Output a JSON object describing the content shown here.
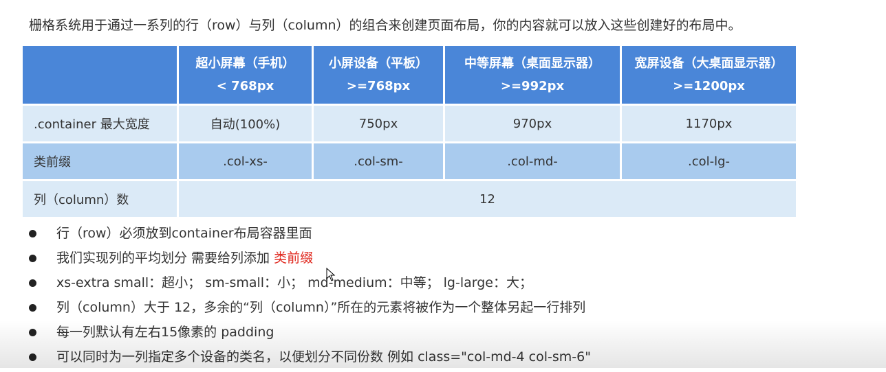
{
  "intro": "栅格系统用于通过一系列的行（row）与列（column）的组合来创建页面布局，你的内容就可以放入这些创建好的布局中。",
  "table": {
    "headers": [
      {
        "title": "",
        "sub": ""
      },
      {
        "title": "超小屏幕（手机）",
        "sub": "< 768px"
      },
      {
        "title": "小屏设备（平板）",
        "sub": ">=768px"
      },
      {
        "title": "中等屏幕（桌面显示器）",
        "sub": ">=992px"
      },
      {
        "title": "宽屏设备（大桌面显示器）",
        "sub": ">=1200px"
      }
    ],
    "rows": [
      {
        "label": ".container 最大宽度",
        "cells": [
          "自动(100%)",
          "750px",
          "970px",
          "1170px"
        ]
      },
      {
        "label": "类前缀",
        "cells": [
          ".col-xs-",
          ".col-sm-",
          ".col-md-",
          ".col-lg-"
        ]
      },
      {
        "label": "列（column）数",
        "merged": "12"
      }
    ]
  },
  "notes": [
    {
      "text": "行（row）必须放到container布局容器里面",
      "highlight": ""
    },
    {
      "text": "我们实现列的平均划分 需要给列添加 ",
      "highlight": "类前缀"
    },
    {
      "text": "xs-extra small：超小； sm-small：小；  md-medium：中等； lg-large：大；",
      "highlight": ""
    },
    {
      "text": "列（column）大于 12，多余的“列（column）”所在的元素将被作为一个整体另起一行排列",
      "highlight": ""
    },
    {
      "text": "每一列默认有左右15像素的 padding",
      "highlight": ""
    },
    {
      "text": "可以同时为一列指定多个设备的类名，以便划分不同份数 例如 class=\"col-md-4 col-sm-6\"",
      "highlight": ""
    }
  ],
  "colors": {
    "header_bg": "#4a86d8",
    "row_light": "#dbeaf7",
    "row_mid": "#a9cbee",
    "highlight": "#e02a20"
  },
  "icons": {
    "cursor": "mouse-pointer-icon",
    "bullet": "bullet-dot-icon"
  }
}
